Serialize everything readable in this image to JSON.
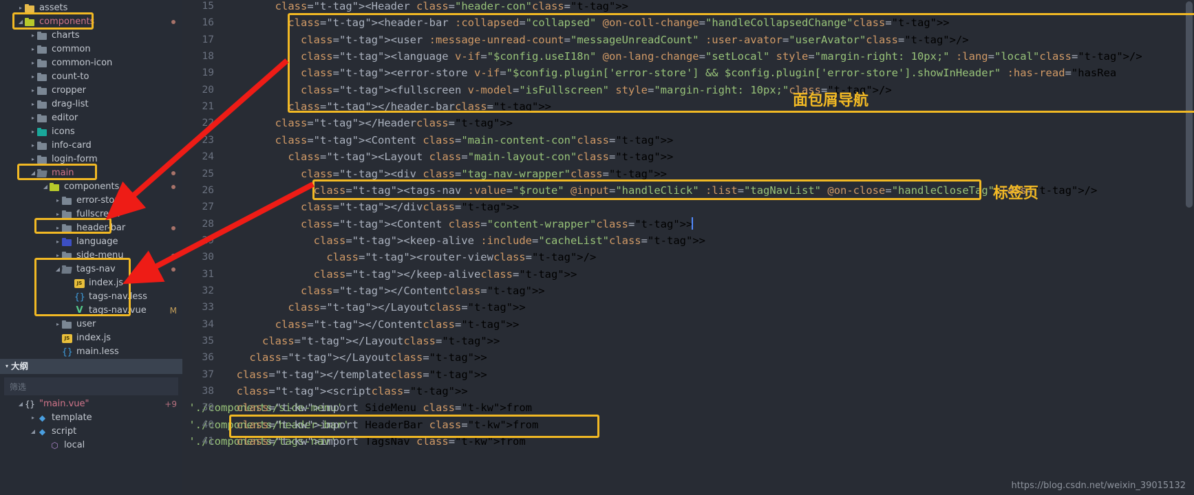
{
  "sidebar": {
    "tree": [
      {
        "indent": 1,
        "arrow": "collapsed",
        "icon": "folder-yellow",
        "label": "assets",
        "color": "normal",
        "dot": false
      },
      {
        "indent": 1,
        "arrow": "expanded",
        "icon": "folder-green",
        "label": "components",
        "color": "red",
        "dot": true
      },
      {
        "indent": 2,
        "arrow": "collapsed",
        "icon": "folder",
        "label": "charts",
        "color": "normal",
        "dot": false
      },
      {
        "indent": 2,
        "arrow": "collapsed",
        "icon": "folder",
        "label": "common",
        "color": "normal",
        "dot": false
      },
      {
        "indent": 2,
        "arrow": "collapsed",
        "icon": "folder",
        "label": "common-icon",
        "color": "normal",
        "dot": false
      },
      {
        "indent": 2,
        "arrow": "collapsed",
        "icon": "folder",
        "label": "count-to",
        "color": "normal",
        "dot": false
      },
      {
        "indent": 2,
        "arrow": "collapsed",
        "icon": "folder",
        "label": "cropper",
        "color": "normal",
        "dot": false
      },
      {
        "indent": 2,
        "arrow": "collapsed",
        "icon": "folder",
        "label": "drag-list",
        "color": "normal",
        "dot": false
      },
      {
        "indent": 2,
        "arrow": "collapsed",
        "icon": "folder",
        "label": "editor",
        "color": "normal",
        "dot": false
      },
      {
        "indent": 2,
        "arrow": "collapsed",
        "icon": "folder-teal",
        "label": "icons",
        "color": "normal",
        "dot": false
      },
      {
        "indent": 2,
        "arrow": "collapsed",
        "icon": "folder",
        "label": "info-card",
        "color": "normal",
        "dot": false
      },
      {
        "indent": 2,
        "arrow": "collapsed",
        "icon": "folder",
        "label": "login-form",
        "color": "normal",
        "dot": false
      },
      {
        "indent": 2,
        "arrow": "expanded",
        "icon": "folder-open",
        "label": "main",
        "color": "red",
        "dot": true
      },
      {
        "indent": 3,
        "arrow": "expanded",
        "icon": "folder-green",
        "label": "components",
        "color": "normal",
        "dot": true
      },
      {
        "indent": 4,
        "arrow": "collapsed",
        "icon": "folder",
        "label": "error-store",
        "color": "normal",
        "dot": false
      },
      {
        "indent": 4,
        "arrow": "collapsed",
        "icon": "folder",
        "label": "fullscreen",
        "color": "normal",
        "dot": false
      },
      {
        "indent": 4,
        "arrow": "collapsed",
        "icon": "folder",
        "label": "header-bar",
        "color": "normal",
        "dot": true
      },
      {
        "indent": 4,
        "arrow": "collapsed",
        "icon": "folder-blue",
        "label": "language",
        "color": "normal",
        "dot": false
      },
      {
        "indent": 4,
        "arrow": "collapsed",
        "icon": "folder",
        "label": "side-menu",
        "color": "normal",
        "dot": true
      },
      {
        "indent": 4,
        "arrow": "expanded",
        "icon": "folder-open",
        "label": "tags-nav",
        "color": "normal",
        "dot": true
      },
      {
        "indent": 5,
        "arrow": "none",
        "icon": "js",
        "label": "index.js",
        "color": "normal",
        "dot": false
      },
      {
        "indent": 5,
        "arrow": "none",
        "icon": "less",
        "label": "tags-nav.less",
        "color": "normal",
        "dot": false
      },
      {
        "indent": 5,
        "arrow": "none",
        "icon": "vue",
        "label": "tags-nav.vue",
        "color": "normal",
        "dot": false,
        "flag": "M"
      },
      {
        "indent": 4,
        "arrow": "collapsed",
        "icon": "folder",
        "label": "user",
        "color": "normal",
        "dot": false
      },
      {
        "indent": 4,
        "arrow": "none",
        "icon": "js",
        "label": "index.js",
        "color": "normal",
        "dot": false
      },
      {
        "indent": 4,
        "arrow": "none",
        "icon": "less",
        "label": "main.less",
        "color": "normal",
        "dot": false
      }
    ],
    "outline": {
      "title": "大纲",
      "filter_placeholder": "筛选",
      "items": [
        {
          "indent": 1,
          "arrow": "expanded",
          "icon": "braces",
          "label": "\"main.vue\"",
          "color": "red",
          "badge": "+9"
        },
        {
          "indent": 2,
          "arrow": "collapsed",
          "icon": "tag",
          "label": "template",
          "color": "normal",
          "badge": ""
        },
        {
          "indent": 2,
          "arrow": "expanded",
          "icon": "tag",
          "label": "script",
          "color": "normal",
          "badge": ""
        },
        {
          "indent": 3,
          "arrow": "none",
          "icon": "cube",
          "label": "local",
          "color": "normal",
          "badge": ""
        }
      ]
    }
  },
  "editor": {
    "first_line_number": 15,
    "lines": [
      {
        "n": 15,
        "text": "        <Header class=\"header-con\">"
      },
      {
        "n": 16,
        "text": "          <header-bar :collapsed=\"collapsed\" @on-coll-change=\"handleCollapsedChange\">"
      },
      {
        "n": 17,
        "text": "            <user :message-unread-count=\"messageUnreadCount\" :user-avator=\"userAvator\"/>"
      },
      {
        "n": 18,
        "text": "            <language v-if=\"$config.useI18n\" @on-lang-change=\"setLocal\" style=\"margin-right: 10px;\" :lang=\"local\"/>"
      },
      {
        "n": 19,
        "text": "            <error-store v-if=\"$config.plugin['error-store'] && $config.plugin['error-store'].showInHeader\" :has-read=\"hasRea"
      },
      {
        "n": 20,
        "text": "            <fullscreen v-model=\"isFullscreen\" style=\"margin-right: 10px;\"/>"
      },
      {
        "n": 21,
        "text": "          </header-bar>"
      },
      {
        "n": 22,
        "text": "        </Header>"
      },
      {
        "n": 23,
        "text": "        <Content class=\"main-content-con\">"
      },
      {
        "n": 24,
        "text": "          <Layout class=\"main-layout-con\">"
      },
      {
        "n": 25,
        "text": "            <div class=\"tag-nav-wrapper\">"
      },
      {
        "n": 26,
        "text": "              <tags-nav :value=\"$route\" @input=\"handleClick\" :list=\"tagNavList\" @on-close=\"handleCloseTag\"/>"
      },
      {
        "n": 27,
        "text": "            </div>"
      },
      {
        "n": 28,
        "text": "            <Content class=\"content-wrapper\">"
      },
      {
        "n": 29,
        "text": "              <keep-alive :include=\"cacheList\">"
      },
      {
        "n": 30,
        "text": "                <router-view/>"
      },
      {
        "n": 31,
        "text": "              </keep-alive>"
      },
      {
        "n": 32,
        "text": "            </Content>"
      },
      {
        "n": 33,
        "text": "          </Layout>"
      },
      {
        "n": 34,
        "text": "        </Content>"
      },
      {
        "n": 35,
        "text": "      </Layout>"
      },
      {
        "n": 36,
        "text": "    </Layout>"
      },
      {
        "n": 37,
        "text": "  </template>"
      },
      {
        "n": 38,
        "text": "  <script>"
      },
      {
        "n": 39,
        "text": "  import SideMenu from './components/side-menu'"
      },
      {
        "n": 40,
        "text": "  import HeaderBar from './components/header-bar'"
      },
      {
        "n": 41,
        "text": "  import TagsNav from './components/tags-nav'"
      }
    ]
  },
  "annotations": {
    "breadcrumb_label": "面包屑导航",
    "tab_label": "标签页"
  },
  "watermark": "https://blog.csdn.net/weixin_39015132",
  "colors": {
    "highlight": "#f2b924",
    "arrow": "#ee1c16",
    "editor_bg": "#282c34",
    "sidebar_bg": "#272c35"
  }
}
